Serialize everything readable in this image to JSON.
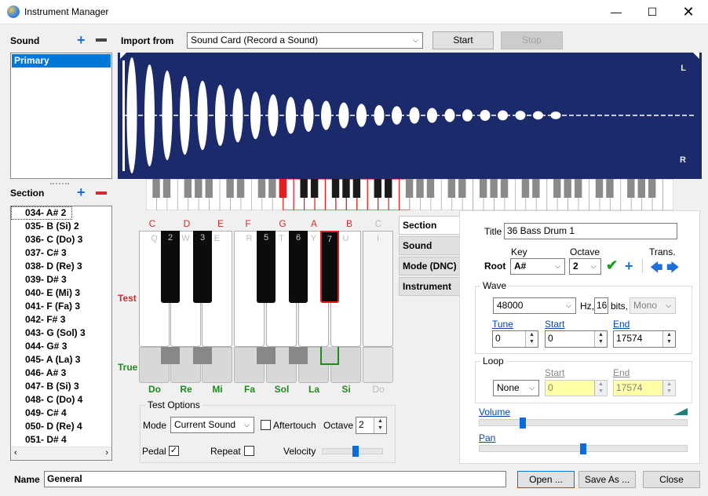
{
  "window": {
    "title": "Instrument Manager"
  },
  "sound": {
    "label": "Sound",
    "items": [
      "Primary"
    ]
  },
  "import": {
    "label": "Import from",
    "source": "Sound Card (Record a Sound)",
    "start_label": "Start",
    "stop_label": "Stop"
  },
  "waveform": {
    "channel_left": "L",
    "channel_right": "R"
  },
  "section": {
    "label": "Section",
    "items": [
      "034- A# 2",
      "035- B (Si) 2",
      "036- C (Do) 3",
      "037- C# 3",
      "038- D (Re) 3",
      "039- D# 3",
      "040- E (Mi) 3",
      "041- F (Fa) 3",
      "042- F# 3",
      "043- G (Sol) 3",
      "044- G# 3",
      "045- A (La) 3",
      "046- A# 3",
      "047- B (Si) 3",
      "048- C (Do) 4",
      "049- C# 4",
      "050- D (Re) 4",
      "051- D# 4"
    ]
  },
  "test_keyboard": {
    "note_letters": [
      "C",
      "D",
      "E",
      "F",
      "G",
      "A",
      "B",
      "C"
    ],
    "white_key_labels": [
      "Q",
      "W",
      "E",
      "R",
      "T",
      "Y",
      "U",
      "I"
    ],
    "black_key_labels": [
      "2",
      "3",
      "5",
      "6",
      "7"
    ],
    "solfege": [
      "Do",
      "Re",
      "Mi",
      "Fa",
      "Sol",
      "La",
      "Si",
      "Do"
    ],
    "test_label": "Test",
    "true_label": "True"
  },
  "test_options": {
    "title": "Test Options",
    "mode_label": "Mode",
    "mode_value": "Current Sound",
    "aftertouch_label": "Aftertouch",
    "octave_label": "Octave",
    "octave_value": "2",
    "pedal_label": "Pedal",
    "repeat_label": "Repeat",
    "velocity_label": "Velocity",
    "velocity_level": 0.55
  },
  "tabs": [
    "Section",
    "Sound",
    "Mode (DNC)",
    "Instrument"
  ],
  "section_panel": {
    "title_label": "Title",
    "title_value": "36 Bass Drum 1",
    "root_label": "Root",
    "key_label": "Key",
    "key_value": "A#",
    "octave_label": "Octave",
    "octave_value": "2",
    "trans_label": "Trans.",
    "wave_label": "Wave",
    "sample_rate": "48000",
    "hz_label": "Hz,",
    "bits_value": "16",
    "bits_label": "bits,",
    "channels": "Mono",
    "tune_label": "Tune",
    "tune_value": "0",
    "start_label": "Start",
    "start_value": "0",
    "end_label": "End",
    "end_value": "17574",
    "loop_label": "Loop",
    "loop_mode": "None",
    "loop_start_label": "Start",
    "loop_start_value": "0",
    "loop_end_label": "End",
    "loop_end_value": "17574",
    "volume_label": "Volume",
    "volume_level": 0.2,
    "pan_label": "Pan",
    "pan_level": 0.5
  },
  "footer": {
    "name_label": "Name",
    "name_value": "General",
    "open_label": "Open ...",
    "saveas_label": "Save As ...",
    "close_label": "Close"
  },
  "colors": {
    "accent": "#0078d7",
    "waveform_bg": "#1b2a6b",
    "note_red": "#c83030",
    "solfege_green": "#1f8a1f",
    "highlight_key": "#e02020",
    "true_key": "#1f8a1f"
  }
}
